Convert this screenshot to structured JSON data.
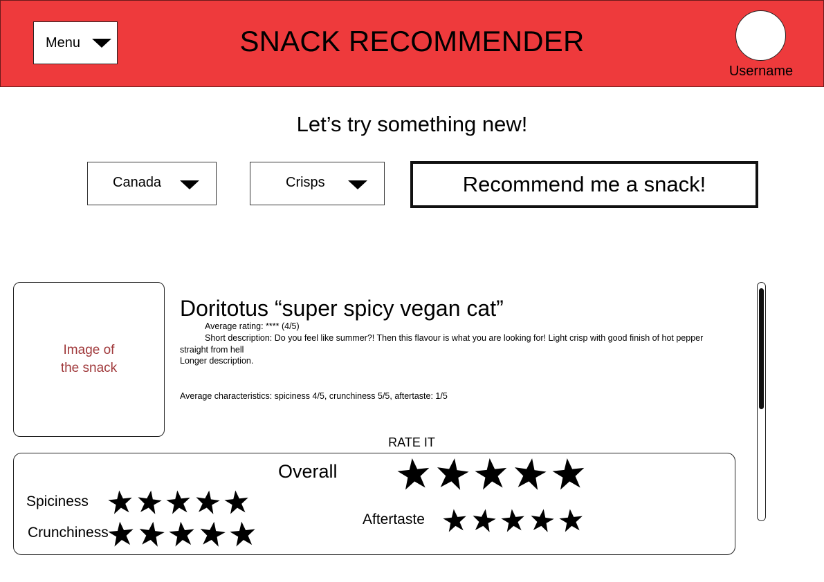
{
  "header": {
    "menu_label": "Menu",
    "title": "SNACK RECOMMENDER",
    "username": "Username"
  },
  "tagline": "Let’s try something new!",
  "filters": {
    "country": "Canada",
    "snack_type": "Crisps",
    "recommend_label": "Recommend me a snack!"
  },
  "snack": {
    "image_placeholder": "Image of the snack",
    "name": "Doritotus “super spicy vegan cat”",
    "average_rating": "Average rating: **** (4/5)",
    "short_description": "Short description: Do you feel like summer?! Then this flavour is what you are looking for! Light crisp with good finish of hot pepper straight from hell",
    "longer_description": "Longer description.",
    "average_characteristics": "Average characteristics: spiciness 4/5, crunchiness 5/5,  aftertaste: 1/5"
  },
  "rating": {
    "title": "RATE IT",
    "overall_label": "Overall",
    "spiciness_label": "Spiciness",
    "crunchiness_label": "Crunchiness",
    "aftertaste_label": "Aftertaste",
    "max_stars": 5
  },
  "colors": {
    "header_bg": "#ee3a3c",
    "placeholder_text": "#a0393b"
  },
  "icons": {
    "menu_dropdown": "triangle-down-icon",
    "rating_star": "star-icon",
    "avatar": "avatar-circle"
  }
}
